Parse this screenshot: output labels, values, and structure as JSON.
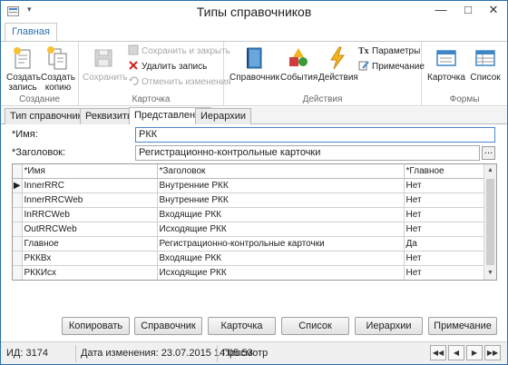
{
  "window": {
    "title": "Типы справочников"
  },
  "ribbon": {
    "tab": "Главная",
    "groups": {
      "create": {
        "label": "Создание",
        "create_record": "Создать запись",
        "create_copy": "Создать копию"
      },
      "card": {
        "label": "Карточка",
        "save": "Сохранить",
        "save_close": "Сохранить и закрыть",
        "delete_record": "Удалить запись",
        "cancel_changes": "Отменить изменения"
      },
      "actions": {
        "label": "Действия",
        "reference": "Справочник",
        "events": "События",
        "actions": "Действия",
        "params": "Параметры",
        "note": "Примечание"
      },
      "forms": {
        "label": "Формы",
        "card": "Карточка",
        "list": "Список"
      }
    }
  },
  "tabs": [
    "Тип справочника",
    "Реквизиты",
    "Представления",
    "Иерархии"
  ],
  "form": {
    "name_label": "*Имя:",
    "name_value": "РКК",
    "header_label": "*Заголовок:",
    "header_value": "Регистрационно-контрольные карточки"
  },
  "grid": {
    "columns": [
      "*Имя",
      "*Заголовок",
      "*Главное"
    ],
    "rows": [
      [
        "InnerRRC",
        "Внутренние РКК",
        "Нет"
      ],
      [
        "InnerRRCWeb",
        "Внутренние РКК",
        "Нет"
      ],
      [
        "InRRCWeb",
        "Входящие РКК",
        "Нет"
      ],
      [
        "OutRRCWeb",
        "Исходящие РКК",
        "Нет"
      ],
      [
        "Главное",
        "Регистрационно-контрольные карточки",
        "Да"
      ],
      [
        "РККВх",
        "Входящие РКК",
        "Нет"
      ],
      [
        "РККИсх",
        "Исходящие РКК",
        "Нет"
      ]
    ]
  },
  "buttons": {
    "copy": "Копировать",
    "reference": "Справочник",
    "card": "Карточка",
    "list": "Список",
    "hierarchy": "Иерархии",
    "note": "Примечание"
  },
  "status": {
    "id": "ИД: 3174",
    "modified": "Дата изменения: 23.07.2015 14:05:53",
    "mode": "Просмотр"
  },
  "colors": {
    "accent": "#2b6fb0",
    "delete_red": "#d22020"
  }
}
